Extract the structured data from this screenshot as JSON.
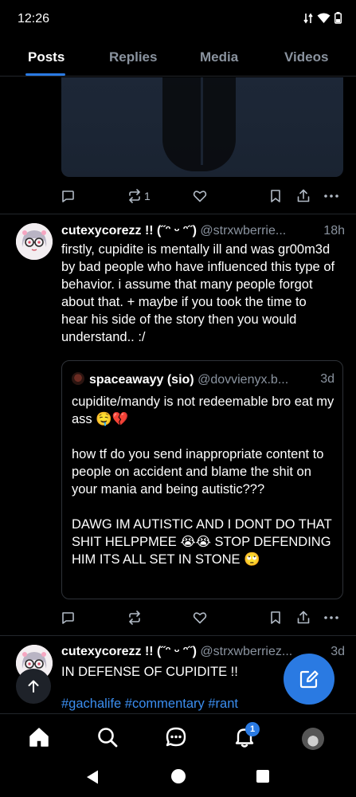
{
  "status_bar": {
    "time": "12:26"
  },
  "tabs": [
    {
      "label": "Posts",
      "active": true
    },
    {
      "label": "Replies",
      "active": false
    },
    {
      "label": "Media",
      "active": false
    },
    {
      "label": "Videos",
      "active": false
    }
  ],
  "post1": {
    "repost_count": "1"
  },
  "post2": {
    "author": "cutexycorezz !! (˝ᵔ ᵕ ᵔ˝)",
    "handle": "@strxwberrie...",
    "time": "18h",
    "text": "firstly, cupidite is mentally ill and was gr00m3d by bad people who have influenced this type of behavior. i assume that many people forgot about that. + maybe if you took the time to hear his side of the story then you would understand.. :/",
    "quote": {
      "author": "spaceawayy (sio)",
      "handle": "@dovvienyx.b...",
      "time": "3d",
      "text": "cupidite/mandy is not redeemable bro eat my ass 🤤💔\n\nhow tf do you send inappropriate content to people on accident and blame the shit on your mania and being autistic???\n\nDAWG IM AUTISTIC AND I DONT DO THAT SHIT HELPPMEE 😭😭 STOP DEFENDING HIM ITS ALL SET IN STONE 🙄"
    }
  },
  "post3": {
    "author": "cutexycorezz !! (˝ᵔ ᵕ ᵔ˝)",
    "handle": "@strxwberriez...",
    "time": "3d",
    "text": "IN DEFENSE OF CUPIDITE !!",
    "hashtags": "#gachalife #commentary #rant"
  },
  "bottom_nav": {
    "items": [
      "home-icon",
      "search-icon",
      "chat-icon",
      "notifications-icon",
      "profile-avatar"
    ],
    "notification_badge": "1"
  },
  "colors": {
    "accent": "#2a7ae2",
    "background": "#000000",
    "muted": "#8a939f"
  }
}
